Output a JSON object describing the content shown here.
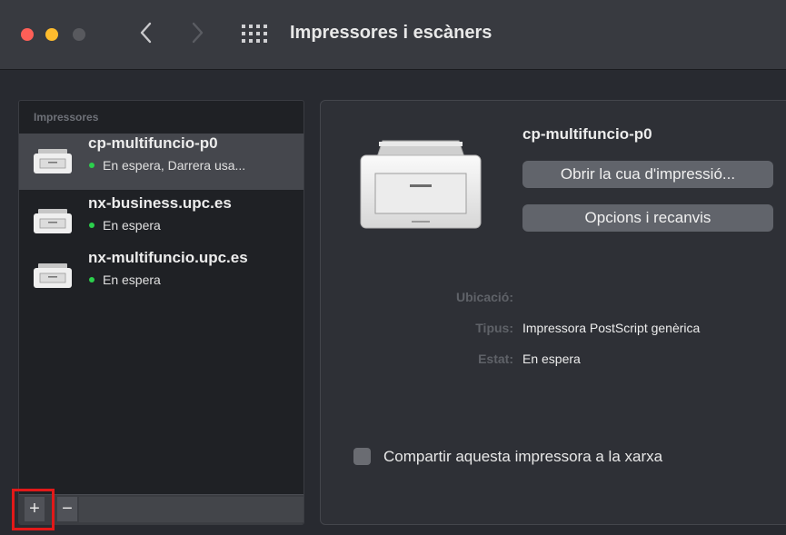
{
  "window": {
    "title": "Impressores i escàners"
  },
  "sidebar": {
    "heading": "Impressores",
    "printers": [
      {
        "name": "cp-multifuncio-p0",
        "status": "En espera, Darrera usa...",
        "selected": true
      },
      {
        "name": "nx-business.upc.es",
        "status": "En espera",
        "selected": false
      },
      {
        "name": "nx-multifuncio.upc.es",
        "status": "En espera",
        "selected": false
      }
    ],
    "add_label": "+",
    "remove_label": "−"
  },
  "detail": {
    "name": "cp-multifuncio-p0",
    "open_queue_label": "Obrir la cua d'impressió...",
    "options_label": "Opcions i recanvis",
    "location_label": "Ubicació:",
    "location_value": "",
    "type_label": "Tipus:",
    "type_value": "Impressora PostScript genèrica",
    "state_label": "Estat:",
    "state_value": "En espera",
    "share_label": "Compartir aquesta impressora a la xarxa",
    "share_checked": false
  },
  "colors": {
    "status_idle": "#2bd04c",
    "highlight": "#e21919"
  }
}
